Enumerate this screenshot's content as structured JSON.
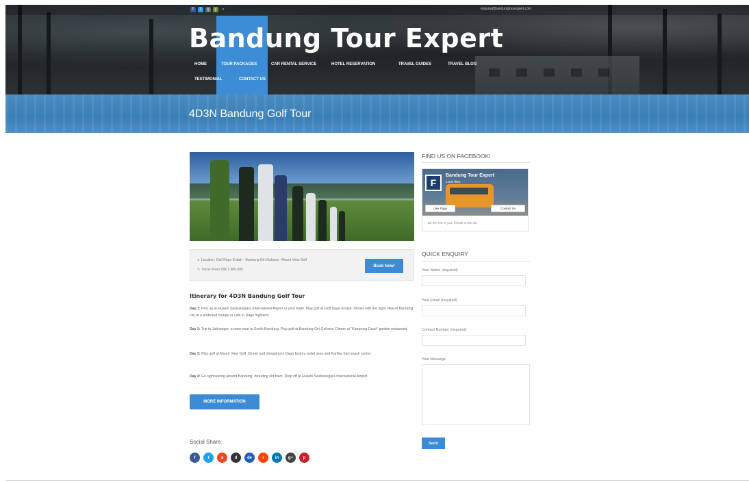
{
  "topbar": {
    "social_icons": [
      "facebook-icon",
      "twitter-icon",
      "google-plus-icon",
      "youtube-icon"
    ],
    "email": "enquiry@bandungtourexpert.com"
  },
  "brand": {
    "title": "Bandung Tour Expert"
  },
  "nav": {
    "items": [
      {
        "label": "HOME"
      },
      {
        "label": "TOUR PACKAGES",
        "active": true
      },
      {
        "label": "CAR RENTAL SERVICE"
      },
      {
        "label": "HOTEL RESERVATION"
      },
      {
        "label": "TRAVEL GUIDES"
      },
      {
        "label": "TRAVEL BLOG"
      },
      {
        "label": "TESTIMONIAL"
      },
      {
        "label": "CONTACT US"
      }
    ]
  },
  "page": {
    "title": "4D3N Bandung Golf Tour"
  },
  "tour": {
    "location": "Location: Golf Dago Endah - Bandung Giri Gahana - Mount View Golf",
    "price": "Price: From IDR 1.900.000",
    "book_label": "Book Now!",
    "itinerary_title": "Itinerary for 4D3N Bandung Golf Tour",
    "days": [
      {
        "label": "Day 1:",
        "text": "Pick up at Husein Sastranegara International Airport or your hotel. Play golf at Golf Dago Endah. Dinner with the night view of Bandung city at a preferred lounge or cafe in Dago highland."
      },
      {
        "label": "Day 2:",
        "text": "Trip to Jatinangor, a town near to South Bandung. Play golf at Bandung Giri Gahana. Dinner at \"Kampung Daun\" garden restaurant."
      },
      {
        "label": "Day 3:",
        "text": "Play golf at Mount View Golf. Dinner and shopping in Dago factory outlet area and Kartika Sari snack center."
      },
      {
        "label": "Day 4:",
        "text": "Go sightseeing around Bandung, including old town. Drop off at Husein Sastranegara International Airport."
      }
    ],
    "more_label": "MORE INFORMATION"
  },
  "social_share": {
    "title": "Social Share",
    "icons": [
      {
        "name": "facebook-icon",
        "glyph": "f",
        "color": "#3b5998"
      },
      {
        "name": "twitter-icon",
        "glyph": "t",
        "color": "#1da1f2"
      },
      {
        "name": "stumbleupon-icon",
        "glyph": "s",
        "color": "#eb4924"
      },
      {
        "name": "digg-icon",
        "glyph": "d",
        "color": "#333333"
      },
      {
        "name": "delicious-icon",
        "glyph": "de",
        "color": "#205cc0"
      },
      {
        "name": "reddit-icon",
        "glyph": "r",
        "color": "#ff4500"
      },
      {
        "name": "linkedin-icon",
        "glyph": "in",
        "color": "#0077b5"
      },
      {
        "name": "google-plus-icon",
        "glyph": "g+",
        "color": "#444444"
      },
      {
        "name": "pinterest-icon",
        "glyph": "p",
        "color": "#cb2027"
      }
    ]
  },
  "sidebar": {
    "facebook_title": "FIND US ON FACEBOOK!",
    "fb_page_name": "Bandung Tour Expert",
    "fb_likes": "1,000 likes",
    "fb_like_label": "Like Page",
    "fb_contact_label": "Contact Us",
    "fb_footer": "Be the first of your friends to like this",
    "enquiry_title": "QUICK ENQUIRY",
    "name_label": "Your Name (required)",
    "email_label": "Your Email (required)",
    "phone_label": "Contact Number (required)",
    "message_label": "Your Message",
    "send_label": "Send"
  },
  "colors": {
    "accent": "#3d8bd4",
    "banner": "#3a7fb8",
    "header": "#23292c"
  }
}
